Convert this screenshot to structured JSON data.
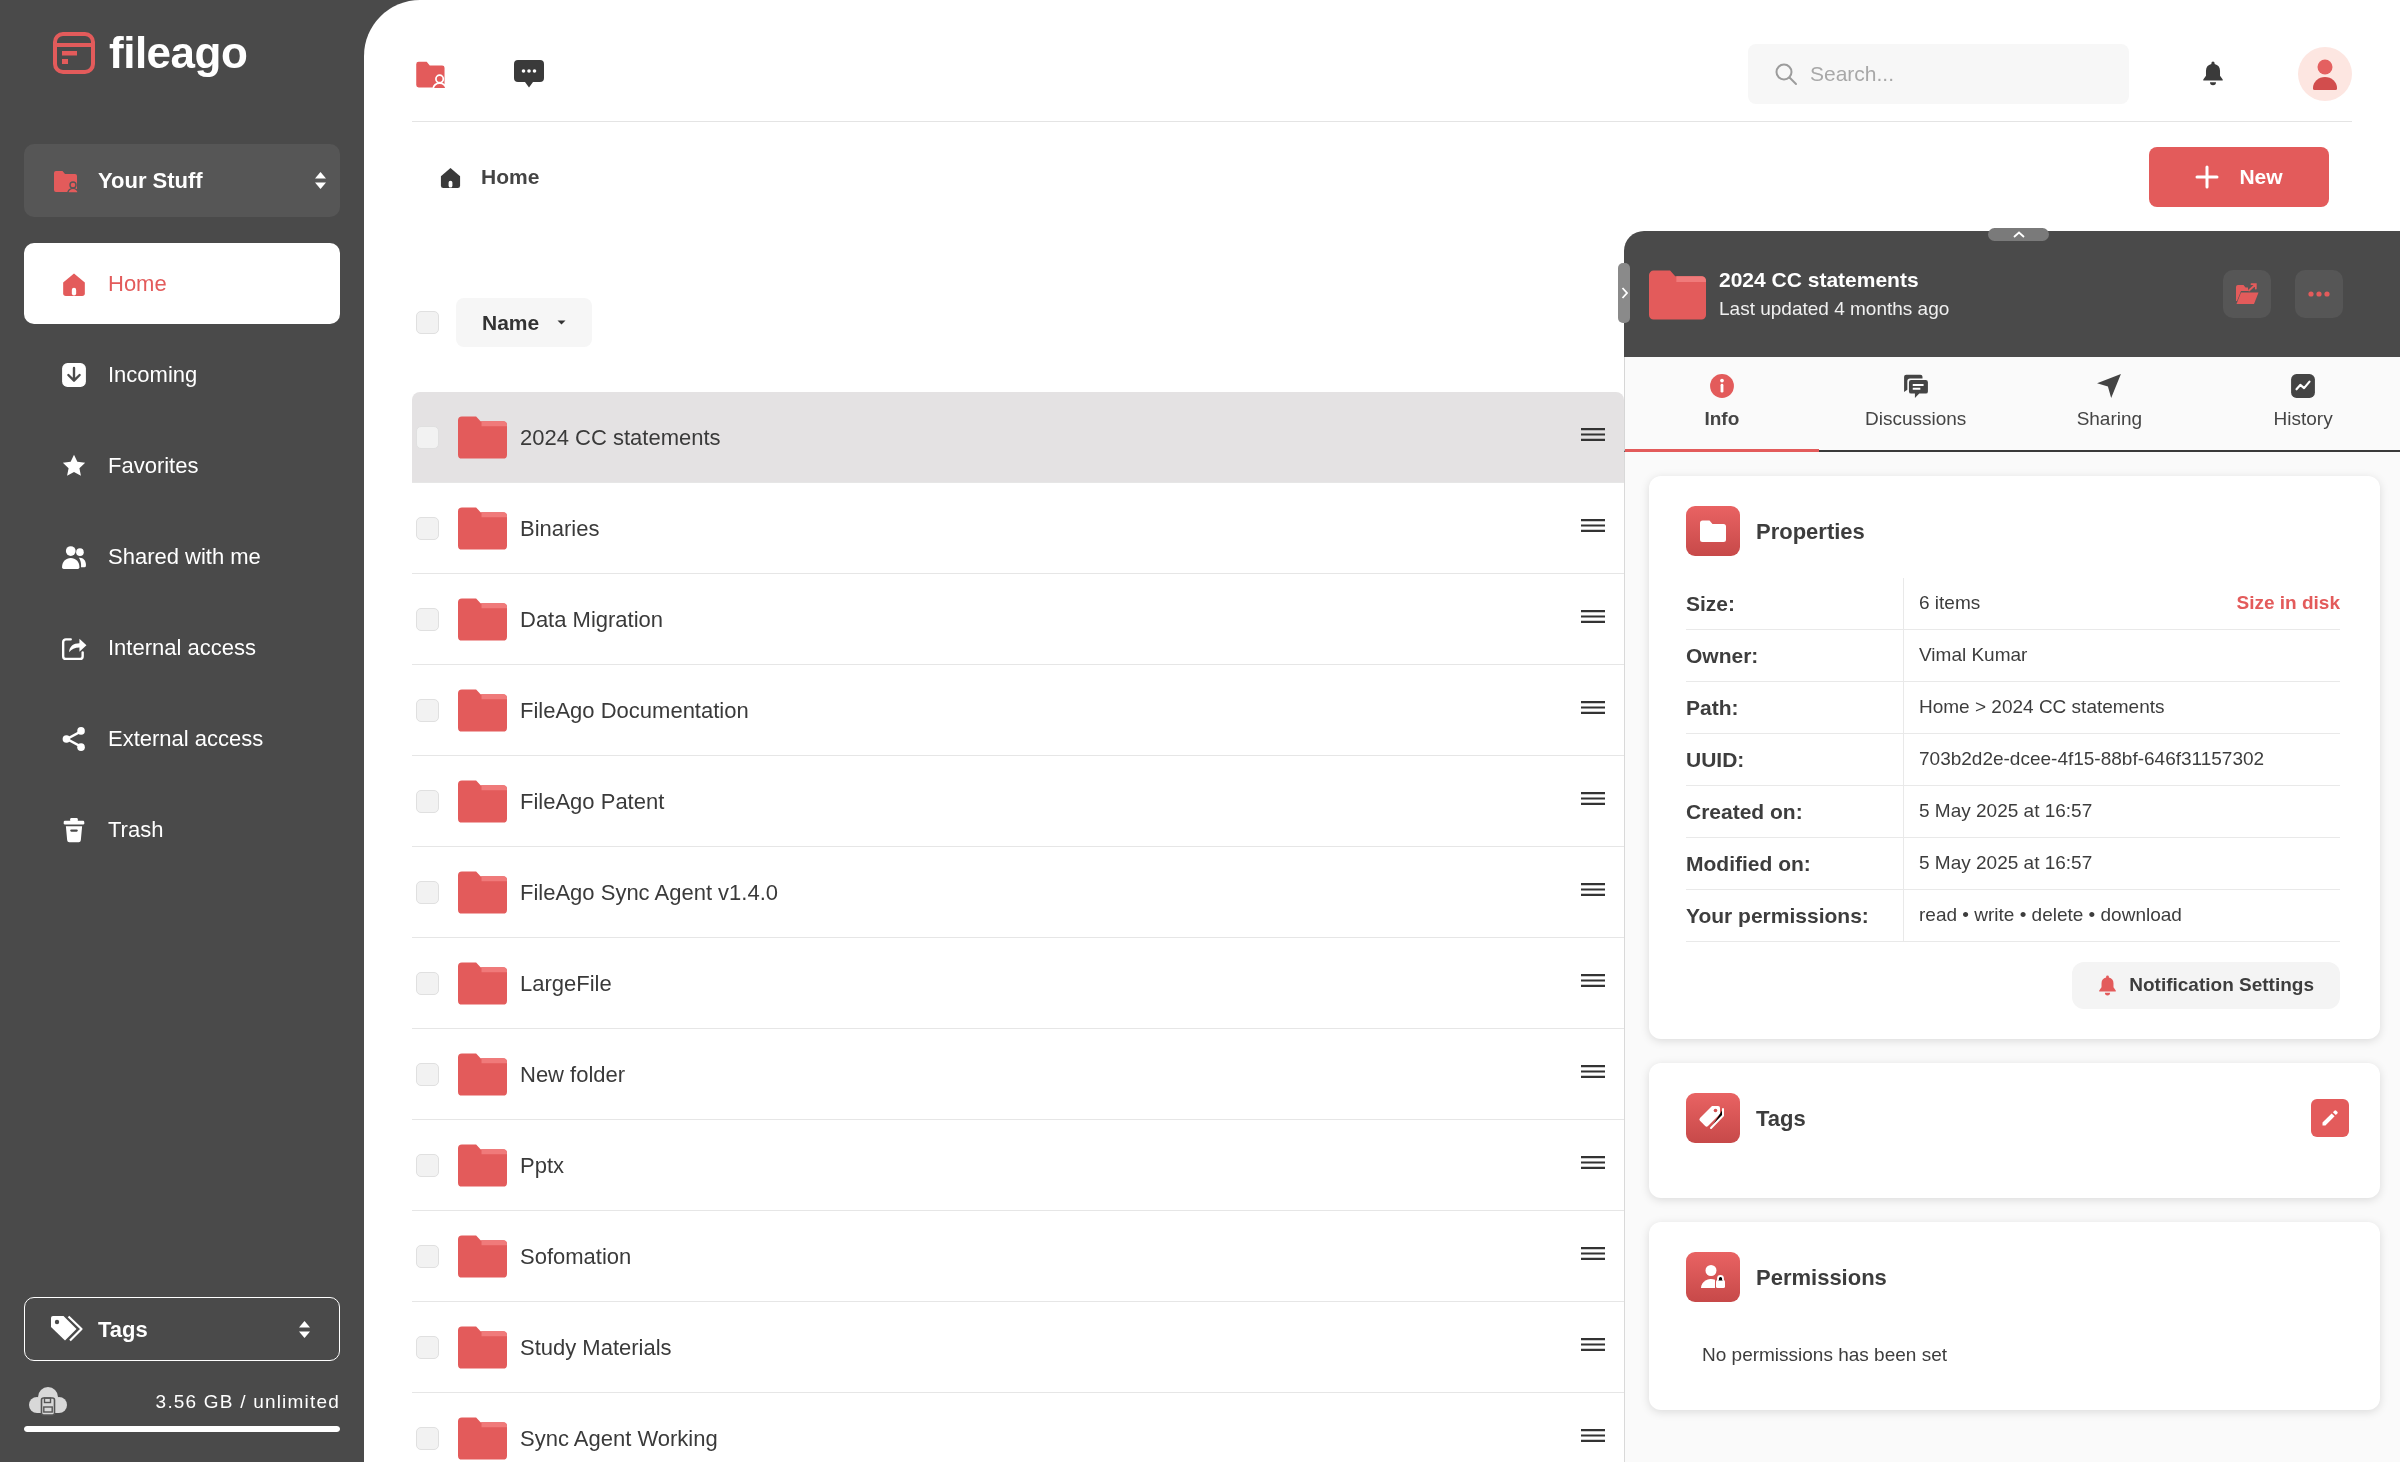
{
  "logo": {
    "text": "fileago"
  },
  "sidebar": {
    "workspace": {
      "label": "Your Stuff"
    },
    "items": [
      {
        "label": "Home",
        "selected": true
      },
      {
        "label": "Incoming",
        "selected": false
      },
      {
        "label": "Favorites",
        "selected": false
      },
      {
        "label": "Shared with me",
        "selected": false
      },
      {
        "label": "Internal access",
        "selected": false
      },
      {
        "label": "External access",
        "selected": false
      },
      {
        "label": "Trash",
        "selected": false
      }
    ],
    "tags": {
      "label": "Tags"
    },
    "storage": {
      "text": "3.56 GB / unlimited",
      "level": 1
    }
  },
  "topbar": {
    "search": {
      "placeholder": "Search..."
    }
  },
  "breadcrumb": [
    {
      "label": "Home"
    }
  ],
  "new_button": {
    "label": "New"
  },
  "list": {
    "select_all": {
      "checked": false
    },
    "sort": {
      "label": "Name"
    },
    "rows": [
      {
        "name": "2024 CC statements",
        "selected": true,
        "checked": false
      },
      {
        "name": "Binaries",
        "selected": false,
        "checked": false
      },
      {
        "name": "Data Migration",
        "selected": false,
        "checked": false
      },
      {
        "name": "FileAgo Documentation",
        "selected": false,
        "checked": false
      },
      {
        "name": "FileAgo Patent",
        "selected": false,
        "checked": false
      },
      {
        "name": "FileAgo Sync Agent v1.4.0",
        "selected": false,
        "checked": false
      },
      {
        "name": "LargeFile",
        "selected": false,
        "checked": false
      },
      {
        "name": "New folder",
        "selected": false,
        "checked": false
      },
      {
        "name": "Pptx",
        "selected": false,
        "checked": false
      },
      {
        "name": "Sofomation",
        "selected": false,
        "checked": false
      },
      {
        "name": "Study Materials",
        "selected": false,
        "checked": false
      },
      {
        "name": "Sync Agent Working",
        "selected": false,
        "checked": false
      }
    ]
  },
  "details": {
    "title": "2024 CC statements",
    "subtitle": "Last updated 4 months ago",
    "tabs": [
      {
        "label": "Info",
        "selected": true
      },
      {
        "label": "Discussions",
        "selected": false
      },
      {
        "label": "Sharing",
        "selected": false
      },
      {
        "label": "History",
        "selected": false
      }
    ],
    "properties": {
      "title": "Properties",
      "rows": [
        {
          "label": "Size:",
          "value": "6 items",
          "action": "Size in disk"
        },
        {
          "label": "Owner:",
          "value": "Vimal Kumar"
        },
        {
          "label": "Path:",
          "value": "Home > 2024 CC statements"
        },
        {
          "label": "UUID:",
          "value": "703b2d2e-dcee-4f15-88bf-646f31157302"
        },
        {
          "label": "Created on:",
          "value": "5 May 2025 at 16:57"
        },
        {
          "label": "Modified on:",
          "value": "5 May 2025 at 16:57"
        },
        {
          "label": "Your permissions:",
          "value": "read • write • delete • download"
        }
      ],
      "button": "Notification Settings"
    },
    "tags": {
      "title": "Tags"
    },
    "permissions": {
      "title": "Permissions",
      "message": "No permissions has been set"
    }
  }
}
